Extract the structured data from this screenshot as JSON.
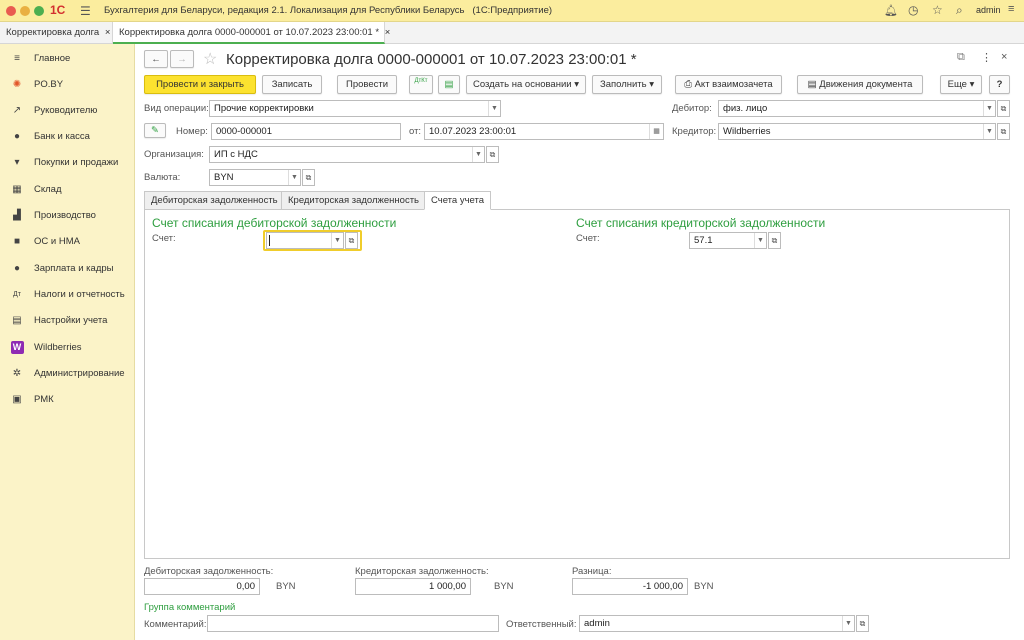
{
  "window": {
    "app_logo": "1С",
    "title": "Бухгалтерия для Беларуси, редакция 2.1. Локализация для Республики Беларусь   (1С:Предприятие)",
    "user": "admin"
  },
  "tabs": [
    {
      "label": "Корректировка долга"
    },
    {
      "label": "Корректировка долга 0000-000001 от 10.07.2023 23:00:01 *"
    }
  ],
  "sidebar": {
    "items": [
      {
        "label": "Главное",
        "icon": "menu-icon"
      },
      {
        "label": "PO.BY",
        "icon": "sun-icon"
      },
      {
        "label": "Руководителю",
        "icon": "trend-icon"
      },
      {
        "label": "Банк и касса",
        "icon": "coin-icon"
      },
      {
        "label": "Покупки и продажи",
        "icon": "cart-icon"
      },
      {
        "label": "Склад",
        "icon": "warehouse-icon"
      },
      {
        "label": "Производство",
        "icon": "factory-icon"
      },
      {
        "label": "ОС и НМА",
        "icon": "truck-icon"
      },
      {
        "label": "Зарплата и кадры",
        "icon": "person-icon"
      },
      {
        "label": "Налоги и отчетность",
        "icon": "tax-icon"
      },
      {
        "label": "Настройки учета",
        "icon": "book-icon"
      },
      {
        "label": "Wildberries",
        "icon": "wb-icon"
      },
      {
        "label": "Администрирование",
        "icon": "gear-icon"
      },
      {
        "label": "РМК",
        "icon": "register-icon"
      }
    ],
    "wb_letter": "W"
  },
  "doc": {
    "title": "Корректировка долга 0000-000001 от 10.07.2023 23:00:01 *"
  },
  "toolbar": {
    "post_close": "Провести и закрыть",
    "save": "Записать",
    "post": "Провести",
    "dtkt": "ДтКт",
    "create_based": "Создать на основании",
    "fill": "Заполнить",
    "act": "Акт взаимозачета",
    "movements": "Движения документа",
    "more": "Еще",
    "help": "?"
  },
  "form": {
    "op_label": "Вид операции:",
    "op_value": "Прочие корректировки",
    "number_label": "Номер:",
    "number_value": "0000-000001",
    "date_label": "от:",
    "date_value": "10.07.2023 23:00:01",
    "org_label": "Организация:",
    "org_value": "ИП с НДС",
    "currency_label": "Валюта:",
    "currency_value": "BYN",
    "debtor_label": "Дебитор:",
    "debtor_value": "физ. лицо",
    "creditor_label": "Кредитор:",
    "creditor_value": "Wildberries"
  },
  "doc_tabs": [
    {
      "label": "Дебиторская задолженность"
    },
    {
      "label": "Кредиторская задолженность"
    },
    {
      "label": "Счета учета"
    }
  ],
  "accounts": {
    "debit_header": "Счет списания дебиторской задолженности",
    "credit_header": "Счет списания кредиторской задолженности",
    "account_label": "Счет:",
    "debit_value": "",
    "credit_value": "57.1"
  },
  "totals": {
    "debit_label": "Дебиторская задолженность:",
    "debit_value": "0,00",
    "credit_label": "Кредиторская задолженность:",
    "credit_value": "1 000,00",
    "diff_label": "Разница:",
    "diff_value": "-1 000,00",
    "currency": "BYN"
  },
  "comments": {
    "group_label": "Группа комментарий",
    "comment_label": "Комментарий:",
    "comment_value": "",
    "responsible_label": "Ответственный:",
    "responsible_value": "admin"
  },
  "colors": {
    "accent": "#fce22f",
    "titlebar": "#fbed9e",
    "sidebar": "#fbf3c8",
    "green_header": "#2e9e3f"
  }
}
